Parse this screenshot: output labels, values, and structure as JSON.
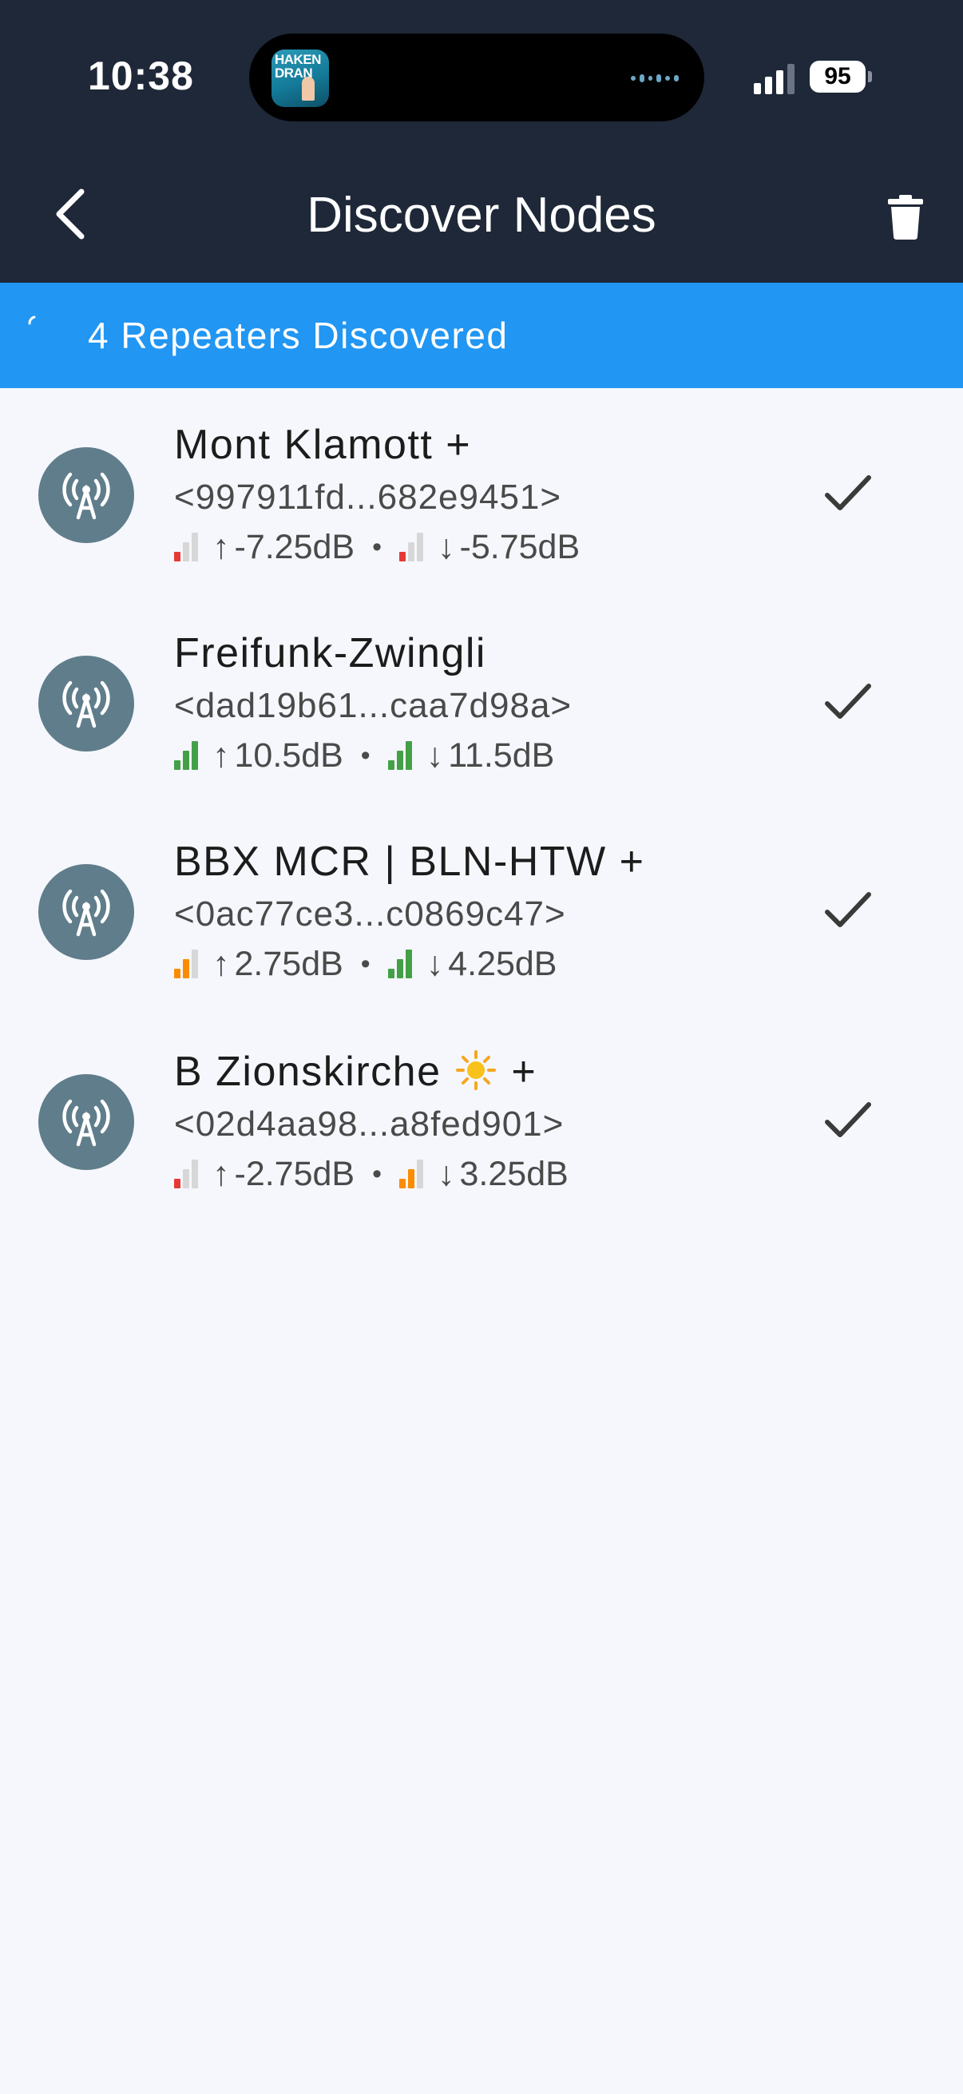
{
  "status_bar": {
    "time": "10:38",
    "battery": "95",
    "now_playing_art_text": "HAKEN DRAN"
  },
  "header": {
    "title": "Discover Nodes",
    "back_icon": "chevron-left-icon",
    "action_icon": "trash-icon"
  },
  "banner": {
    "text": "4 Repeaters Discovered",
    "color": "#2196f3"
  },
  "nodes": [
    {
      "name": "Mont Klamott +",
      "key": "<997911fd...682e9451>",
      "up": {
        "arrow": "↑",
        "value": "-7.25dB",
        "level": 1,
        "color": "#e53935"
      },
      "down": {
        "arrow": "↓",
        "value": "-5.75dB",
        "level": 1,
        "color": "#e53935"
      },
      "selected": true
    },
    {
      "name": "Freifunk-Zwingli",
      "key": "<dad19b61...caa7d98a>",
      "up": {
        "arrow": "↑",
        "value": "10.5dB",
        "level": 3,
        "color": "#43a047"
      },
      "down": {
        "arrow": "↓",
        "value": "11.5dB",
        "level": 3,
        "color": "#43a047"
      },
      "selected": true
    },
    {
      "name": "BBX MCR | BLN-HTW +",
      "key": "<0ac77ce3...c0869c47>",
      "up": {
        "arrow": "↑",
        "value": "2.75dB",
        "level": 2,
        "color": "#fb8c00"
      },
      "down": {
        "arrow": "↓",
        "value": "4.25dB",
        "level": 3,
        "color": "#43a047"
      },
      "selected": true
    },
    {
      "name_before": "B Zionskirche",
      "name_after": "+",
      "name_emoji": "sun-emoji",
      "key": "<02d4aa98...a8fed901>",
      "up": {
        "arrow": "↑",
        "value": "-2.75dB",
        "level": 1,
        "color": "#e53935"
      },
      "down": {
        "arrow": "↓",
        "value": "3.25dB",
        "level": 2,
        "color": "#fb8c00"
      },
      "selected": true
    }
  ],
  "separator": "•"
}
